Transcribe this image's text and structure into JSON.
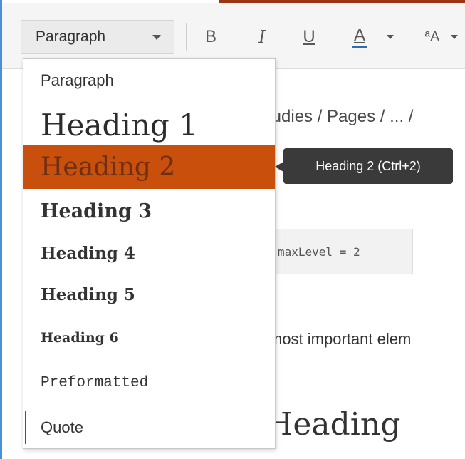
{
  "toolbar": {
    "format_select_value": "Paragraph",
    "bold_label": "B",
    "italic_label": "I",
    "underline_label": "U",
    "font_color_label": "A",
    "text_case_label": "ªA"
  },
  "background": {
    "breadcrumb": "tudies / Pages / ... /",
    "code_text": "maxLevel = 2",
    "body_text": "most important elem",
    "heading_text": "Heading"
  },
  "dropdown": {
    "items": [
      {
        "label": "Paragraph"
      },
      {
        "label": "Heading 1"
      },
      {
        "label": "Heading 2"
      },
      {
        "label": "Heading 3"
      },
      {
        "label": "Heading 4"
      },
      {
        "label": "Heading 5"
      },
      {
        "label": "Heading 6"
      },
      {
        "label": "Preformatted"
      },
      {
        "label": "Quote"
      }
    ],
    "highlighted": "Heading 2"
  },
  "tooltip": {
    "text": "Heading 2 (Ctrl+2)"
  },
  "colors": {
    "highlight": "#c94f0d",
    "accent_border": "#4a90d9",
    "tooltip_bg": "#3a3a3a"
  }
}
